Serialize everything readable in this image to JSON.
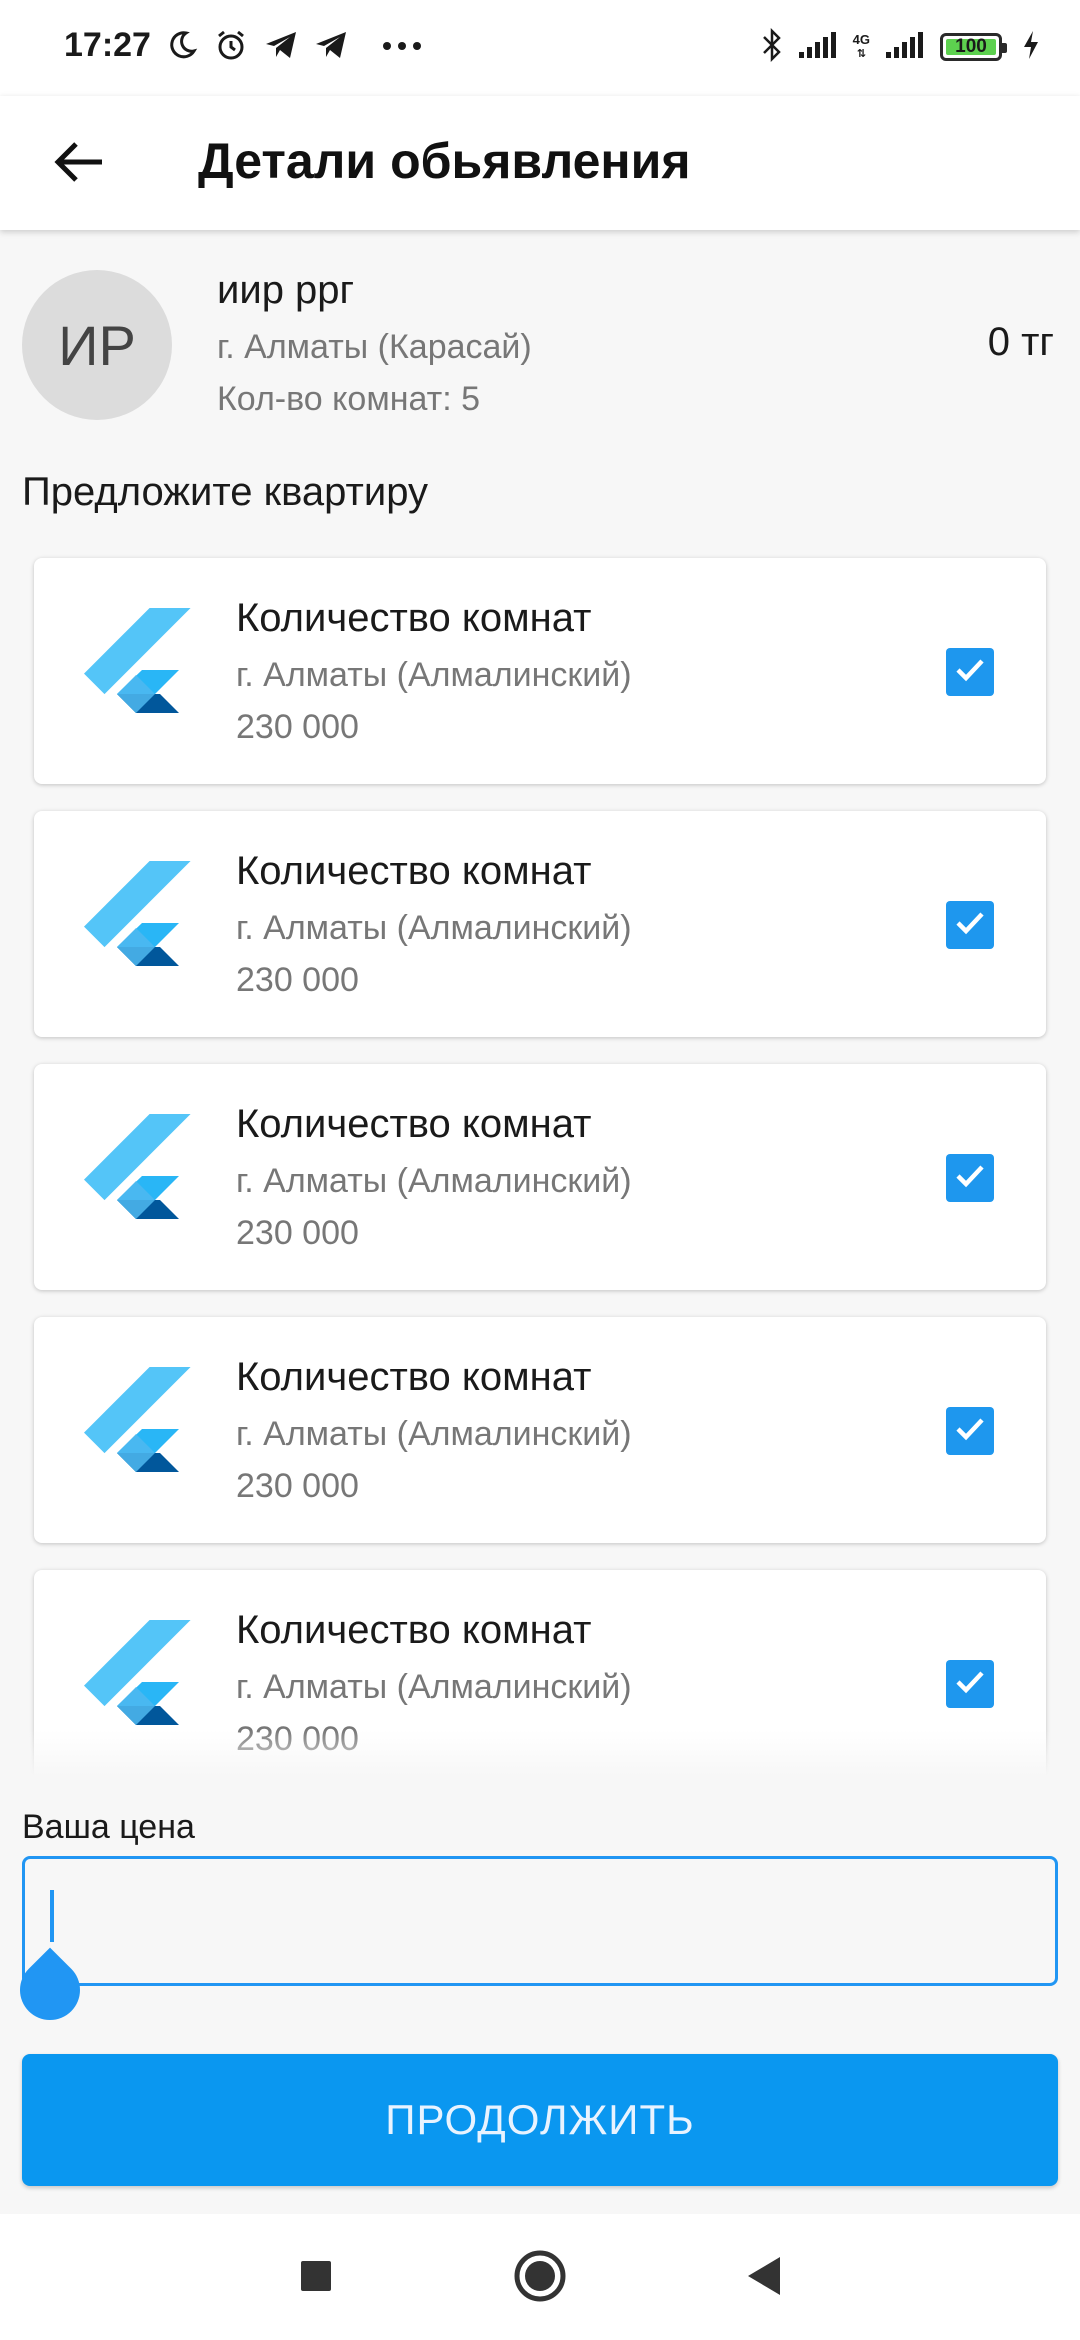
{
  "status_bar": {
    "time": "17:27",
    "battery": "100",
    "network": "4G",
    "icons": [
      "moon-icon",
      "alarm-icon",
      "telegram-icon",
      "telegram-icon",
      "more-icon",
      "bluetooth-icon",
      "signal-icon",
      "signal-icon",
      "battery-icon",
      "charging-icon"
    ]
  },
  "app_bar": {
    "title": "Детали обьявления",
    "back_icon": "arrow-left-icon"
  },
  "listing": {
    "avatar_initials": "ИР",
    "name": "иир ррг",
    "city": "г. Алматы (Карасай)",
    "rooms": "Кол-во комнат: 5",
    "price": "0 тг"
  },
  "section_title": "Предложите квартиру",
  "offers": [
    {
      "title": "Количество комнат",
      "city": "г. Алматы (Алмалинский)",
      "price": "230 000",
      "checked": true
    },
    {
      "title": "Количество комнат",
      "city": "г. Алматы (Алмалинский)",
      "price": "230 000",
      "checked": true
    },
    {
      "title": "Количество комнат",
      "city": "г. Алматы (Алмалинский)",
      "price": "230 000",
      "checked": true
    },
    {
      "title": "Количество комнат",
      "city": "г. Алматы (Алмалинский)",
      "price": "230 000",
      "checked": true
    },
    {
      "title": "Количество комнат",
      "city": "г. Алматы (Алмалинский)",
      "price": "230 000",
      "checked": true
    }
  ],
  "price_input": {
    "label": "Ваша цена",
    "value": ""
  },
  "continue_button": {
    "label": "ПРОДОЛЖИТЬ"
  },
  "colors": {
    "accent": "#0a97f0",
    "checkbox": "#1e97ee",
    "flutter_light": "#54c5f8",
    "flutter_mid": "#29b6f6",
    "flutter_dark": "#01579b"
  }
}
